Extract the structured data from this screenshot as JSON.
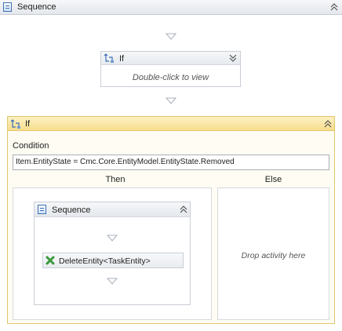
{
  "outer_sequence": {
    "title": "Sequence",
    "icon": "sequence-icon",
    "collapse_icon": "double-chevron-up-icon"
  },
  "collapsed_if": {
    "title": "If",
    "icon": "if-activity-icon",
    "expand_icon": "double-chevron-down-icon",
    "body_text": "Double-click to view"
  },
  "expanded_if": {
    "title": "If",
    "icon": "if-activity-icon",
    "collapse_icon": "double-chevron-up-icon",
    "condition_label": "Condition",
    "condition_value": "Item.EntityState = Cmc.Core.EntityModel.EntityState.Removed",
    "then_label": "Then",
    "else_label": "Else",
    "else_placeholder": "Drop activity here",
    "then_sequence": {
      "title": "Sequence",
      "icon": "sequence-icon",
      "collapse_icon": "double-chevron-up-icon",
      "activity": {
        "label": "DeleteEntity<TaskEntity>",
        "icon": "delete-x-icon"
      }
    }
  },
  "colors": {
    "header_gradient_top": "#f6f7f9",
    "header_gradient_bottom": "#e4e7ec",
    "if_header_top": "#fdf1c4",
    "if_header_bottom": "#f7dd8c",
    "if_border": "#e3c66a",
    "arrow": "#a8b0bc",
    "delete_green": "#3a9a3a"
  }
}
